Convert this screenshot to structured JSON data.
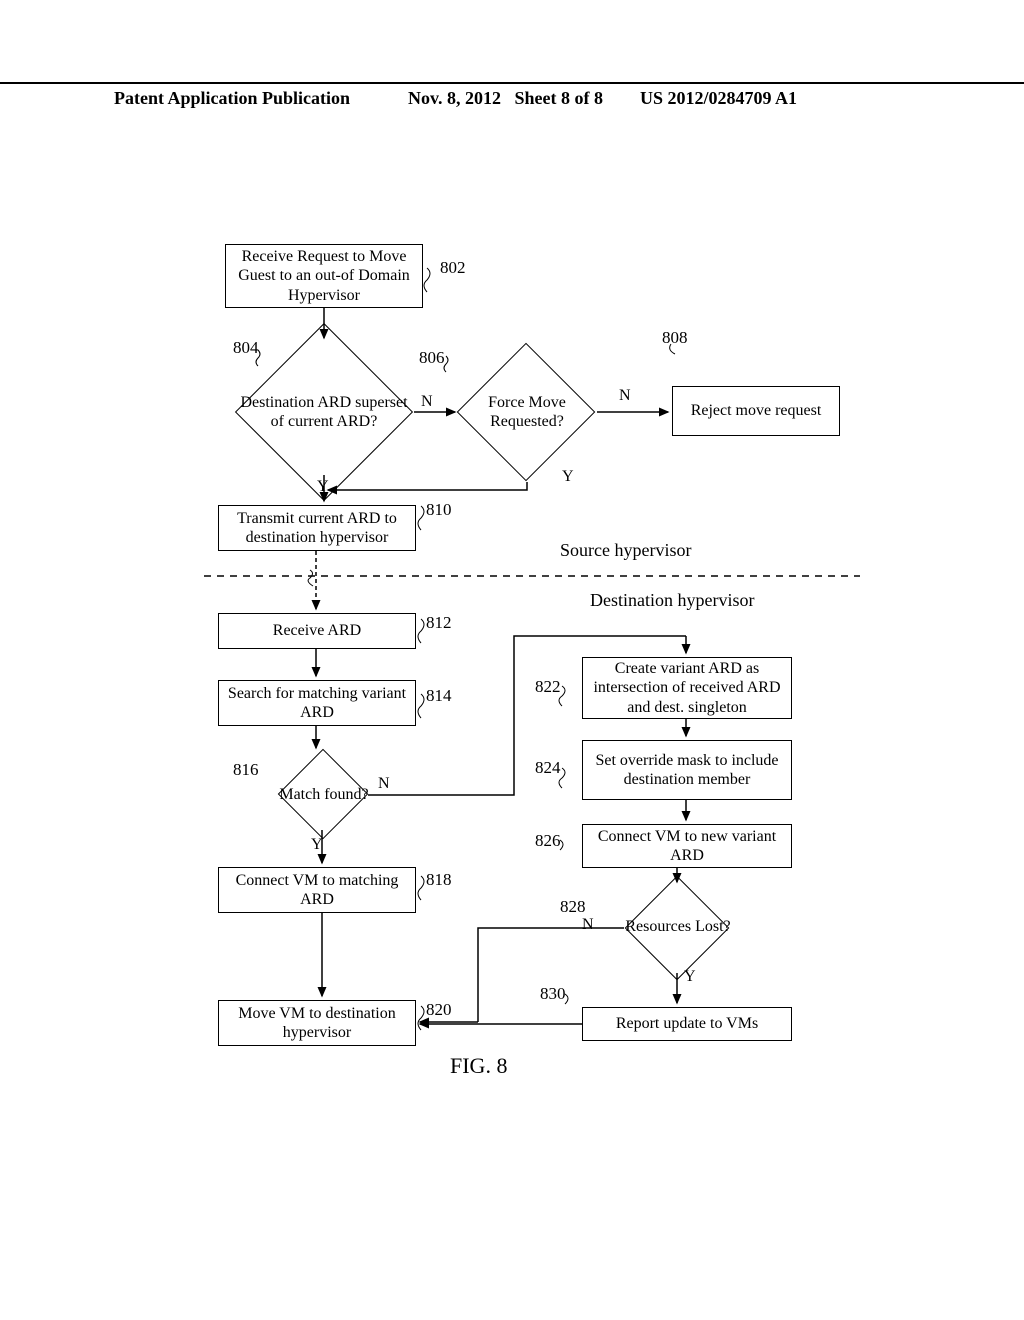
{
  "header": {
    "left": "Patent Application Publication",
    "center": "Nov. 8, 2012",
    "sheet": "Sheet 8 of 8",
    "right": "US 2012/0284709 A1"
  },
  "nodes": {
    "n802": "Receive Request to Move Guest to an out-of Domain Hypervisor",
    "n804": "Destination ARD superset of current ARD?",
    "n806": "Force Move Requested?",
    "n808": "Reject move request",
    "n810": "Transmit current ARD to destination hypervisor",
    "n812": "Receive ARD",
    "n814": "Search for matching variant ARD",
    "n816": "Match found?",
    "n818": "Connect VM to matching ARD",
    "n820": "Move VM to destination hypervisor",
    "n822": "Create variant ARD as intersection of received ARD and dest. singleton",
    "n824": "Set override mask to include destination member",
    "n826": "Connect VM to new variant ARD",
    "n828": "Resources Lost?",
    "n830": "Report update to VMs"
  },
  "refs": {
    "r802": "802",
    "r804": "804",
    "r806": "806",
    "r808": "808",
    "r810": "810",
    "r812": "812",
    "r814": "814",
    "r816": "816",
    "r818": "818",
    "r820": "820",
    "r822": "822",
    "r824": "824",
    "r826": "826",
    "r828": "828",
    "r830": "830"
  },
  "flow": {
    "yes": "Y",
    "no": "N"
  },
  "regions": {
    "source": "Source hypervisor",
    "dest": "Destination hypervisor"
  },
  "figure": "FIG. 8"
}
